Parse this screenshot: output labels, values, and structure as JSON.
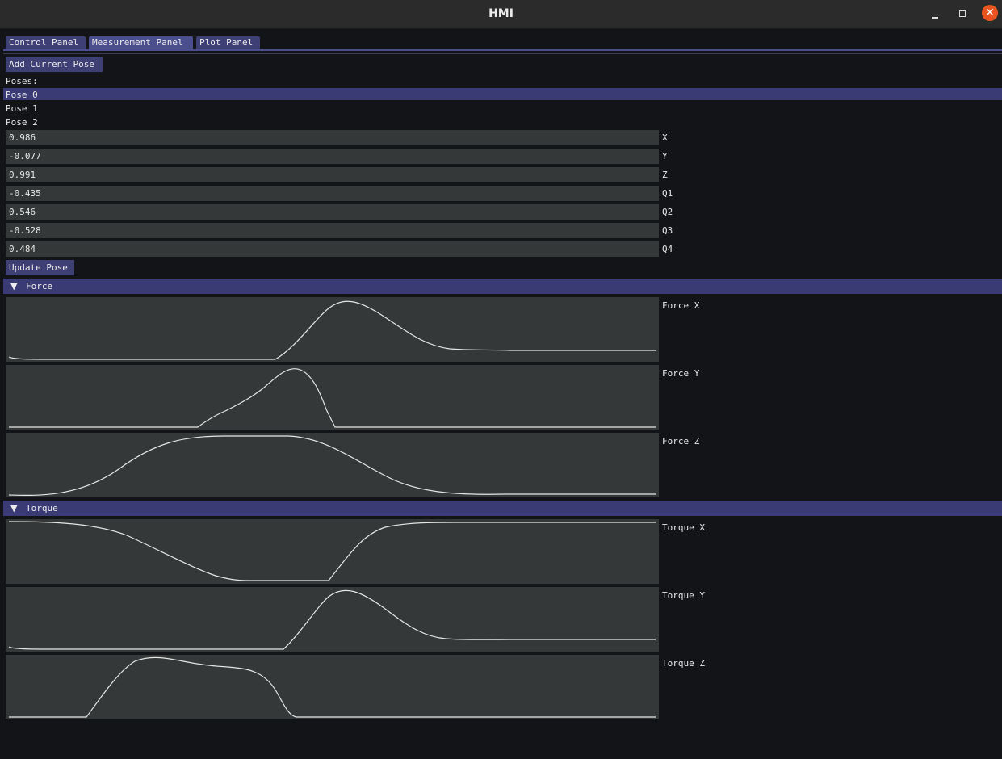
{
  "window": {
    "title": "HMI"
  },
  "tabs": [
    {
      "label": "Control Panel",
      "active": false
    },
    {
      "label": "Measurement Panel",
      "active": true
    },
    {
      "label": "Plot Panel",
      "active": false
    }
  ],
  "control": {
    "add_pose_label": "Add Current Pose",
    "poses_heading": "Poses:",
    "poses": [
      "Pose 0",
      "Pose 1",
      "Pose 2"
    ],
    "selected_pose": "Pose 0",
    "fields": [
      {
        "label": "X",
        "value": "0.986"
      },
      {
        "label": "Y",
        "value": "-0.077"
      },
      {
        "label": "Z",
        "value": "0.991"
      },
      {
        "label": "Q1",
        "value": "-0.435"
      },
      {
        "label": "Q2",
        "value": "0.546"
      },
      {
        "label": "Q3",
        "value": "-0.528"
      },
      {
        "label": "Q4",
        "value": "0.484"
      }
    ],
    "update_pose_label": "Update Pose"
  },
  "sections": {
    "force": {
      "label": "Force",
      "arrow": "▼"
    },
    "torque": {
      "label": "Torque",
      "arrow": "▼"
    }
  },
  "plots": [
    {
      "label": "Force X"
    },
    {
      "label": "Force Y"
    },
    {
      "label": "Force Z"
    },
    {
      "label": "Torque X"
    },
    {
      "label": "Torque Y"
    },
    {
      "label": "Torque Z"
    }
  ],
  "colors": {
    "accent": "#3d3f75",
    "header": "#3a3b75",
    "plot_bg": "#353838",
    "line": "#e6e6e6",
    "close_button": "#e95420"
  }
}
